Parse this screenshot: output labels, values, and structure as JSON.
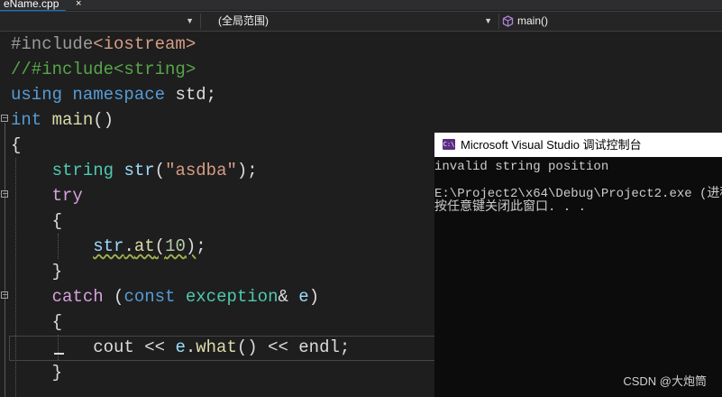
{
  "editor": {
    "tab": {
      "filename": "eName.cpp",
      "close_glyph": "×"
    },
    "nav": {
      "project_combo": "",
      "scope_combo": "(全局范围)",
      "member_combo": "main()",
      "member_icon": "cube-icon"
    },
    "code": {
      "lines": [
        {
          "parts": [
            {
              "text": "#include",
              "cls": "pre"
            },
            {
              "text": "<iostream>",
              "cls": "str"
            }
          ]
        },
        {
          "parts": [
            {
              "text": "//#include<string>",
              "cls": "cmt"
            }
          ]
        },
        {
          "parts": [
            {
              "text": "using",
              "cls": "kw"
            },
            {
              "text": " "
            },
            {
              "text": "namespace",
              "cls": "kw"
            },
            {
              "text": " std;"
            }
          ]
        },
        {
          "parts": [
            {
              "text": "int",
              "cls": "kw"
            },
            {
              "text": " "
            },
            {
              "text": "main",
              "cls": "fn"
            },
            {
              "text": "()"
            }
          ]
        },
        {
          "parts": [
            {
              "text": "{"
            }
          ]
        },
        {
          "parts": [
            {
              "text": "    "
            },
            {
              "text": "string",
              "cls": "typ"
            },
            {
              "text": " "
            },
            {
              "text": "str",
              "cls": "var"
            },
            {
              "text": "("
            },
            {
              "text": "\"asdba\"",
              "cls": "str"
            },
            {
              "text": ");"
            }
          ]
        },
        {
          "parts": [
            {
              "text": "    "
            },
            {
              "text": "try",
              "cls": "ctl"
            }
          ]
        },
        {
          "parts": [
            {
              "text": "    {"
            }
          ]
        },
        {
          "parts": [
            {
              "text": "        "
            },
            {
              "text": "str",
              "cls": "var squiggle"
            },
            {
              "text": ".",
              "cls": "squiggle"
            },
            {
              "text": "at",
              "cls": "fn squiggle"
            },
            {
              "text": "(",
              "cls": "squiggle"
            },
            {
              "text": "10",
              "cls": "num squiggle"
            },
            {
              "text": ")",
              "cls": "squiggle"
            },
            {
              "text": ";"
            }
          ]
        },
        {
          "parts": [
            {
              "text": "    }"
            }
          ]
        },
        {
          "parts": [
            {
              "text": "    "
            },
            {
              "text": "catch",
              "cls": "ctl"
            },
            {
              "text": " ("
            },
            {
              "text": "const",
              "cls": "kw"
            },
            {
              "text": " "
            },
            {
              "text": "exception",
              "cls": "typ"
            },
            {
              "text": "& "
            },
            {
              "text": "e",
              "cls": "var"
            },
            {
              "text": ")"
            }
          ]
        },
        {
          "parts": [
            {
              "text": "    {"
            }
          ]
        },
        {
          "parts": [
            {
              "text": "        cout << "
            },
            {
              "text": "e",
              "cls": "var"
            },
            {
              "text": "."
            },
            {
              "text": "what",
              "cls": "fn"
            },
            {
              "text": "() << endl;"
            }
          ]
        },
        {
          "parts": [
            {
              "text": "    }"
            }
          ]
        }
      ]
    }
  },
  "console": {
    "title": "Microsoft Visual Studio 调试控制台",
    "icon_label": "C:\\",
    "icon": "console-app-icon",
    "lines": [
      "invalid string position",
      "",
      "E:\\Project2\\x64\\Debug\\Project2.exe (进程",
      "按任意键关闭此窗口. . ."
    ]
  },
  "watermark": "CSDN @大炮筒",
  "colors": {
    "editor_bg": "#1e1e1e",
    "keyword": "#569cd6",
    "control": "#d8a0df",
    "type": "#4ec9b0",
    "function": "#dcdcaa",
    "string": "#d69d85",
    "comment": "#57a64a",
    "number": "#b5cea8",
    "console_bg": "#0c0c0c"
  }
}
